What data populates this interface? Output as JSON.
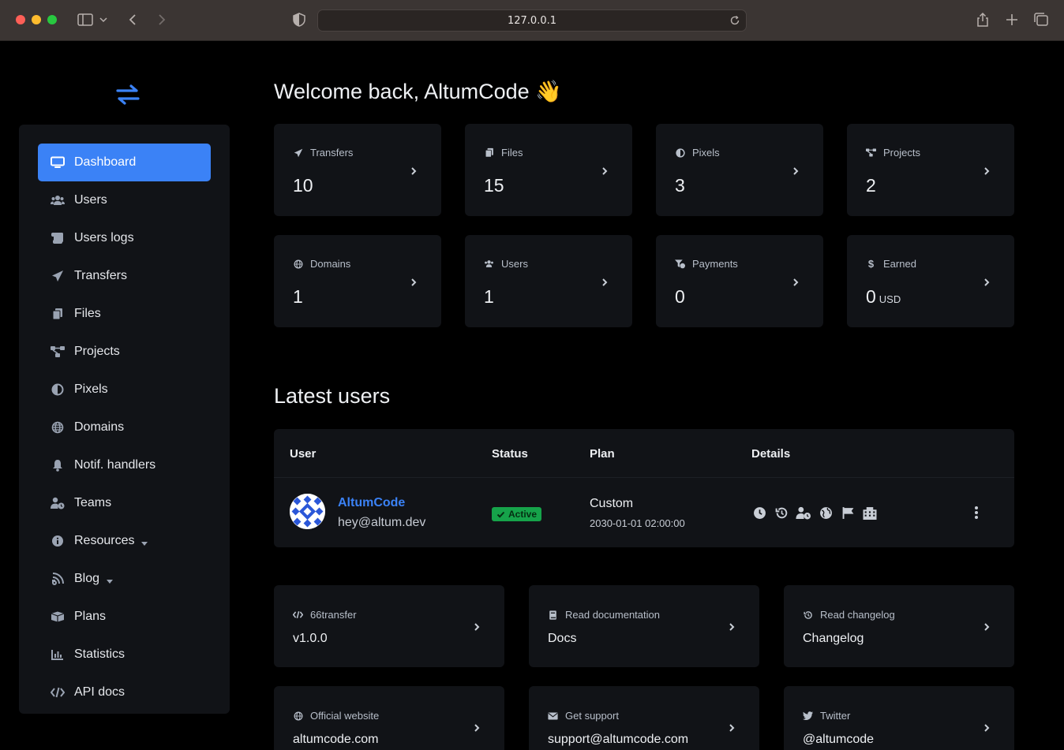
{
  "browser": {
    "url": "127.0.0.1"
  },
  "sidebar": {
    "items": [
      {
        "label": "Dashboard",
        "icon": "monitor-icon",
        "active": true
      },
      {
        "label": "Users",
        "icon": "users-icon"
      },
      {
        "label": "Users logs",
        "icon": "scroll-icon"
      },
      {
        "label": "Transfers",
        "icon": "paper-plane-icon"
      },
      {
        "label": "Files",
        "icon": "copy-icon"
      },
      {
        "label": "Projects",
        "icon": "project-diagram-icon"
      },
      {
        "label": "Pixels",
        "icon": "adjust-icon"
      },
      {
        "label": "Domains",
        "icon": "globe-icon"
      },
      {
        "label": "Notif. handlers",
        "icon": "bell-icon"
      },
      {
        "label": "Teams",
        "icon": "user-clock-icon"
      },
      {
        "label": "Resources",
        "icon": "info-circle-icon",
        "dropdown": true
      },
      {
        "label": "Blog",
        "icon": "blog-icon",
        "dropdown": true
      },
      {
        "label": "Plans",
        "icon": "box-open-icon"
      },
      {
        "label": "Statistics",
        "icon": "chart-bar-icon"
      },
      {
        "label": "API docs",
        "icon": "code-icon"
      }
    ]
  },
  "main": {
    "welcome": "Welcome back, AltumCode 👋",
    "stats": [
      {
        "label": "Transfers",
        "value": "10",
        "icon": "paper-plane-icon"
      },
      {
        "label": "Files",
        "value": "15",
        "icon": "copy-icon"
      },
      {
        "label": "Pixels",
        "value": "3",
        "icon": "adjust-icon"
      },
      {
        "label": "Projects",
        "value": "2",
        "icon": "project-diagram-icon"
      },
      {
        "label": "Domains",
        "value": "1",
        "icon": "globe-icon"
      },
      {
        "label": "Users",
        "value": "1",
        "icon": "users-icon"
      },
      {
        "label": "Payments",
        "value": "0",
        "icon": "funnel-dollar-icon"
      },
      {
        "label": "Earned",
        "value": "0",
        "unit": "USD",
        "icon": "dollar-icon"
      }
    ],
    "latest_users": {
      "title": "Latest users",
      "headers": {
        "user": "User",
        "status": "Status",
        "plan": "Plan",
        "details": "Details"
      },
      "rows": [
        {
          "name": "AltumCode",
          "email": "hey@altum.dev",
          "status": "Active",
          "plan": "Custom",
          "plan_expiry": "2030-01-01 02:00:00",
          "detail_icons": [
            "clock-icon",
            "history-icon",
            "user-clock-icon",
            "globe-icon",
            "flag-icon",
            "building-icon"
          ]
        }
      ]
    },
    "links": [
      {
        "label": "66transfer",
        "value": "v1.0.0",
        "icon": "code-icon"
      },
      {
        "label": "Read documentation",
        "value": "Docs",
        "icon": "book-icon"
      },
      {
        "label": "Read changelog",
        "value": "Changelog",
        "icon": "history-icon"
      },
      {
        "label": "Official website",
        "value": "altumcode.com",
        "icon": "globe-icon"
      },
      {
        "label": "Get support",
        "value": "support@altumcode.com",
        "icon": "envelope-icon"
      },
      {
        "label": "Twitter",
        "value": "@altumcode",
        "icon": "twitter-icon"
      }
    ]
  },
  "colors": {
    "accent": "#3b82f6",
    "card": "#111317",
    "success": "#16a34a"
  }
}
